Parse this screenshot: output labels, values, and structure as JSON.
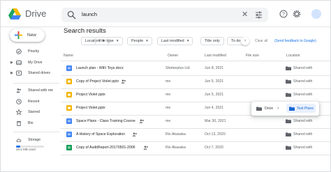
{
  "app": {
    "name": "Drive"
  },
  "search": {
    "query": "launch",
    "clear_icon": "close-icon",
    "options_icon": "tune-icon"
  },
  "header_icons": [
    "help-icon",
    "settings-icon"
  ],
  "sidebar": {
    "new_label": "New",
    "items": [
      {
        "label": "Priority",
        "icon": "check-circle-icon",
        "expandable": false
      },
      {
        "label": "My Drive",
        "icon": "drive-icon",
        "expandable": true
      },
      {
        "label": "Shared drives",
        "icon": "shared-drives-icon",
        "expandable": true
      },
      {
        "label": "Shared with me",
        "icon": "people-icon",
        "expandable": false
      },
      {
        "label": "Recent",
        "icon": "clock-icon",
        "expandable": false
      },
      {
        "label": "Starred",
        "icon": "star-icon",
        "expandable": false
      },
      {
        "label": "Bin",
        "icon": "trash-icon",
        "expandable": false
      },
      {
        "label": "Storage",
        "icon": "cloud-icon",
        "expandable": false
      }
    ],
    "storage_text": "26.5 MB used",
    "storage_fraction": 0.15
  },
  "main": {
    "title": "Search results",
    "chips": [
      "Location",
      "File type",
      "People",
      "Last modified",
      "Title only",
      "To do"
    ],
    "clear_all": "Clear all",
    "feedback": "Send feedback to Google",
    "columns": {
      "name": "Name",
      "owner": "Owner",
      "modified": "Last modified",
      "size": "File size",
      "location": "Location"
    },
    "rows": [
      {
        "name": "Launch plan - WiFi Toys.docx",
        "type": "docx",
        "shared": false,
        "owner": "Sheteeplus Ltd",
        "modified": "Jun 8, 2021",
        "location": "Shared with"
      },
      {
        "name": "Copy of Project Violet pptx",
        "type": "slides",
        "shared": true,
        "owner": "me",
        "modified": "Jun 5, 2021",
        "location": "Shared with"
      },
      {
        "name": "Project Violet pptx",
        "type": "slides",
        "shared": false,
        "owner": "me",
        "modified": "Jun 5, 2021",
        "location": "Shared with"
      },
      {
        "name": "Project Violet.pptx",
        "type": "slides",
        "shared": false,
        "owner": "me",
        "modified": "Jun 4, 2021",
        "location": ""
      },
      {
        "name": "Space Plans - Class Training Course",
        "type": "doc",
        "shared": true,
        "owner": "me",
        "modified": "Mar 30, 2021",
        "location": "Shared with"
      },
      {
        "name": "A History of Space Exploration",
        "type": "doc",
        "shared": true,
        "owner": "Rio Akasaka",
        "modified": "Oct 13, 2020",
        "location": "Shared with"
      },
      {
        "name": "Copy of AuditReport-20170501-2006",
        "type": "sheet",
        "shared": true,
        "owner": "Rio Akasaka",
        "modified": "Oct 7, 2020",
        "location": "Shared with"
      }
    ],
    "location_popup": {
      "root": "Drive",
      "folder": "Test Plans"
    }
  },
  "colors": {
    "accent": "#1a73e8",
    "doc": "#4285f4",
    "slides": "#f4b400",
    "sheet": "#0f9d58"
  }
}
